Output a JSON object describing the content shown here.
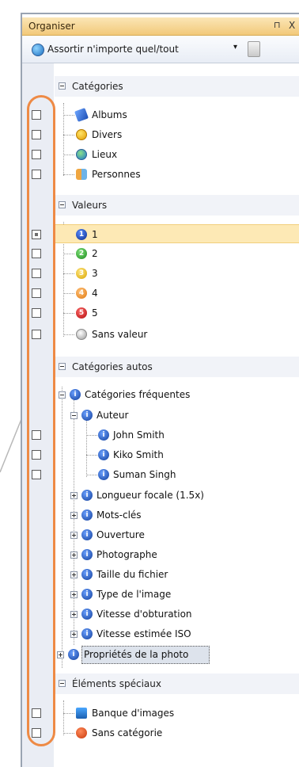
{
  "panel": {
    "title": "Organiser",
    "pin_label": "p",
    "close_label": "X"
  },
  "toolbar": {
    "match_label": "Assortir n'importe quel/tout",
    "dropdown_glyph": "▾"
  },
  "sections": {
    "categories": "Catégories",
    "values": "Valeurs",
    "auto_categories": "Catégories autos",
    "special": "Éléments spéciaux"
  },
  "categories": [
    "Albums",
    "Divers",
    "Lieux",
    "Personnes"
  ],
  "values": [
    "1",
    "2",
    "3",
    "4",
    "5",
    "Sans valeur"
  ],
  "auto": {
    "frequent": "Catégories fréquentes",
    "author": "Auteur",
    "authors": [
      "John Smith",
      "Kiko Smith",
      "Suman Singh"
    ],
    "items": [
      "Longueur focale (1.5x)",
      "Mots-clés",
      "Ouverture",
      "Photographe",
      "Taille du fichier",
      "Type de l'image",
      "Vitesse d'obturation",
      "Vitesse estimée ISO"
    ],
    "photo_props": "Propriétés de la photo"
  },
  "special": [
    "Banque d'images",
    "Sans catégorie"
  ],
  "colors": {
    "accent": "#ee8a45",
    "selected_row": "#fde9b5",
    "titlebar": "#f2c97a"
  }
}
